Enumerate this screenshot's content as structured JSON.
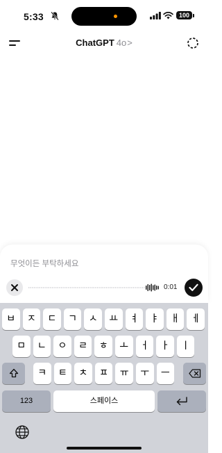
{
  "status_bar": {
    "time": "5:33",
    "battery": "100",
    "accent_color": "#ff9500"
  },
  "header": {
    "app_name": "ChatGPT",
    "model": "4o",
    "chevron": ">",
    "icons": [
      "menu-icon",
      "temporary-chat-icon"
    ]
  },
  "composer": {
    "placeholder": "무엇이든 부탁하세요",
    "timer": "0:01",
    "icons": [
      "close-icon",
      "waveform-icon",
      "checkmark-icon"
    ]
  },
  "keyboard": {
    "row1": [
      "ㅂ",
      "ㅈ",
      "ㄷ",
      "ㄱ",
      "ㅅ",
      "ㅛ",
      "ㅕ",
      "ㅑ",
      "ㅐ",
      "ㅔ"
    ],
    "row2": [
      "ㅁ",
      "ㄴ",
      "ㅇ",
      "ㄹ",
      "ㅎ",
      "ㅗ",
      "ㅓ",
      "ㅏ",
      "ㅣ"
    ],
    "row3": [
      "ㅋ",
      "ㅌ",
      "ㅊ",
      "ㅍ",
      "ㅠ",
      "ㅜ",
      "ㅡ"
    ],
    "numbers_label": "123",
    "space_label": "스페이스",
    "icons": [
      "shift-icon",
      "backspace-icon",
      "return-icon",
      "globe-icon"
    ]
  }
}
